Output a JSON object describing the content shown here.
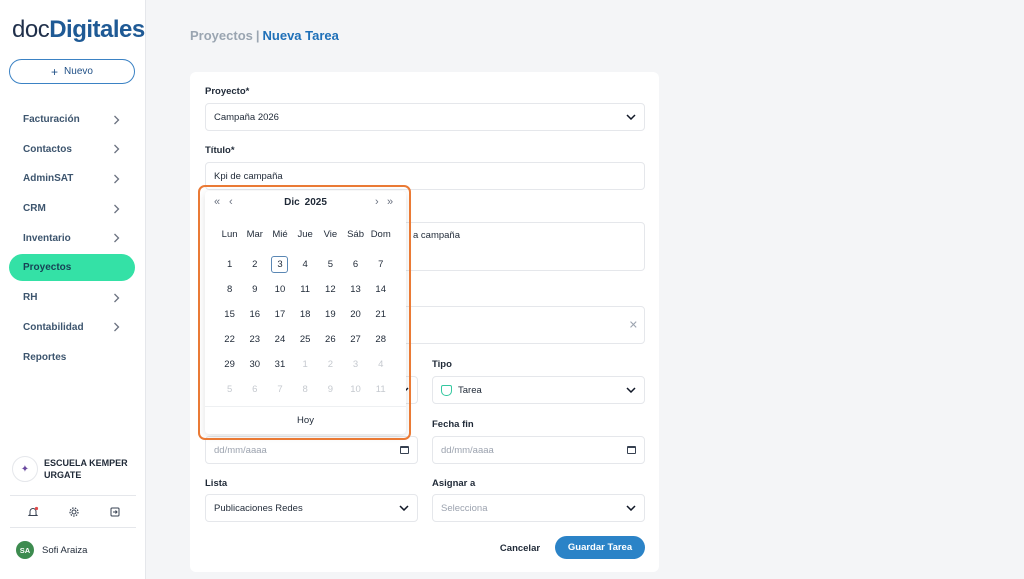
{
  "brand": {
    "part1": "doc",
    "part2": "Digitales"
  },
  "sidebar": {
    "new_label": "Nuevo",
    "items": [
      {
        "label": "Facturación",
        "has_chevron": true
      },
      {
        "label": "Contactos",
        "has_chevron": true
      },
      {
        "label": "AdminSAT",
        "has_chevron": true
      },
      {
        "label": "CRM",
        "has_chevron": true
      },
      {
        "label": "Inventario",
        "has_chevron": true
      },
      {
        "label": "Proyectos",
        "has_chevron": false,
        "active": true
      },
      {
        "label": "RH",
        "has_chevron": true
      },
      {
        "label": "Contabilidad",
        "has_chevron": true
      },
      {
        "label": "Reportes",
        "has_chevron": false
      }
    ],
    "org": {
      "line1": "ESCUELA KEMPER",
      "line2": "URGATE"
    },
    "tools": [
      "bell-icon",
      "gear-icon",
      "logout-icon"
    ],
    "user": {
      "initials": "SA",
      "name": "Sofi Araiza"
    }
  },
  "breadcrumb": {
    "parent": "Proyectos",
    "separator": "|",
    "current": "Nueva Tarea"
  },
  "form": {
    "project_label": "Proyecto*",
    "project_value": "Campaña 2026",
    "title_label": "Título*",
    "title_value": "Kpi de campaña",
    "description_visible": "a campaña",
    "tipo_label": "Tipo",
    "tipo_value": "Tarea",
    "fecha_fin_label": "Fecha fin",
    "date_placeholder": "dd/mm/aaaa",
    "lista_label": "Lista",
    "lista_value": "Publicaciones Redes",
    "asignar_label": "Asignar a",
    "asignar_placeholder": "Selecciona",
    "cancel_label": "Cancelar",
    "save_label": "Guardar Tarea"
  },
  "datepicker": {
    "month": "Dic",
    "year": "2025",
    "prev_year": "«",
    "prev_month": "‹",
    "next_month": "›",
    "next_year": "»",
    "weekdays": [
      "Lun",
      "Mar",
      "Mié",
      "Jue",
      "Vie",
      "Sáb",
      "Dom"
    ],
    "weeks": [
      [
        {
          "d": "1"
        },
        {
          "d": "2"
        },
        {
          "d": "3",
          "today": true
        },
        {
          "d": "4"
        },
        {
          "d": "5"
        },
        {
          "d": "6"
        },
        {
          "d": "7"
        }
      ],
      [
        {
          "d": "8"
        },
        {
          "d": "9"
        },
        {
          "d": "10"
        },
        {
          "d": "11"
        },
        {
          "d": "12"
        },
        {
          "d": "13"
        },
        {
          "d": "14"
        }
      ],
      [
        {
          "d": "15"
        },
        {
          "d": "16"
        },
        {
          "d": "17"
        },
        {
          "d": "18"
        },
        {
          "d": "19"
        },
        {
          "d": "20"
        },
        {
          "d": "21"
        }
      ],
      [
        {
          "d": "22"
        },
        {
          "d": "23"
        },
        {
          "d": "24"
        },
        {
          "d": "25"
        },
        {
          "d": "26"
        },
        {
          "d": "27"
        },
        {
          "d": "28"
        }
      ],
      [
        {
          "d": "29"
        },
        {
          "d": "30"
        },
        {
          "d": "31"
        },
        {
          "d": "1",
          "muted": true
        },
        {
          "d": "2",
          "muted": true
        },
        {
          "d": "3",
          "muted": true
        },
        {
          "d": "4",
          "muted": true
        }
      ],
      [
        {
          "d": "5",
          "muted": true
        },
        {
          "d": "6",
          "muted": true
        },
        {
          "d": "7",
          "muted": true
        },
        {
          "d": "8",
          "muted": true
        },
        {
          "d": "9",
          "muted": true
        },
        {
          "d": "10",
          "muted": true
        },
        {
          "d": "11",
          "muted": true
        }
      ]
    ],
    "today_label": "Hoy",
    "highlight_color": "#ea7a35"
  }
}
